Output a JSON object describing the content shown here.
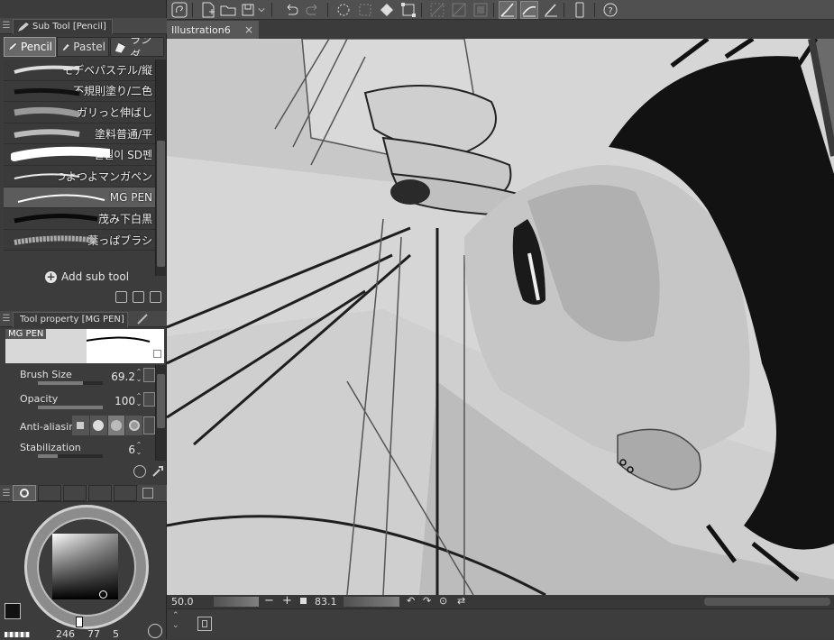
{
  "subtool_panel": {
    "title": "Sub Tool [Pencil]",
    "tabs": [
      {
        "label": "Pencil",
        "icon": "pencil-icon"
      },
      {
        "label": "Pastel",
        "icon": "pastel-icon"
      },
      {
        "label": "ランダ",
        "icon": "random-icon"
      }
    ],
    "items": [
      {
        "label": "モデベパステル/縦"
      },
      {
        "label": "不規則塗り/二色"
      },
      {
        "label": "ガリっと伸ばし"
      },
      {
        "label": "塗料普通/平"
      },
      {
        "label": "필필이 SD펜"
      },
      {
        "label": "つよつよマンガペン"
      },
      {
        "label": "MG PEN"
      },
      {
        "label": "茂み下白黒"
      },
      {
        "label": "葉っぱブラシ"
      }
    ],
    "add_label": "Add sub tool"
  },
  "tool_property": {
    "title": "Tool property [MG PEN]",
    "preview_name": "MG PEN",
    "brush_size": {
      "label": "Brush Size",
      "value": "69.2",
      "fill": 0.7
    },
    "opacity": {
      "label": "Opacity",
      "value": "100",
      "fill": 1.0
    },
    "anti_aliasing": {
      "label": "Anti-aliasing"
    },
    "stabilization": {
      "label": "Stabilization",
      "value": "6",
      "fill": 0.3
    }
  },
  "color_panel": {
    "readout": {
      "h": "246",
      "s": "77",
      "v": "5"
    },
    "main_color": "#111111",
    "sub_color": "#b0b0b0"
  },
  "canvas": {
    "tab_label": "Illustration6",
    "zoom": "50.0",
    "rotation": "83.1"
  },
  "colors": {
    "panel_bg": "#3c3c3c",
    "toolbar_bg": "#505050",
    "canvas_paper": "#d6d6d6",
    "selected_item": "#5c5c5c"
  }
}
